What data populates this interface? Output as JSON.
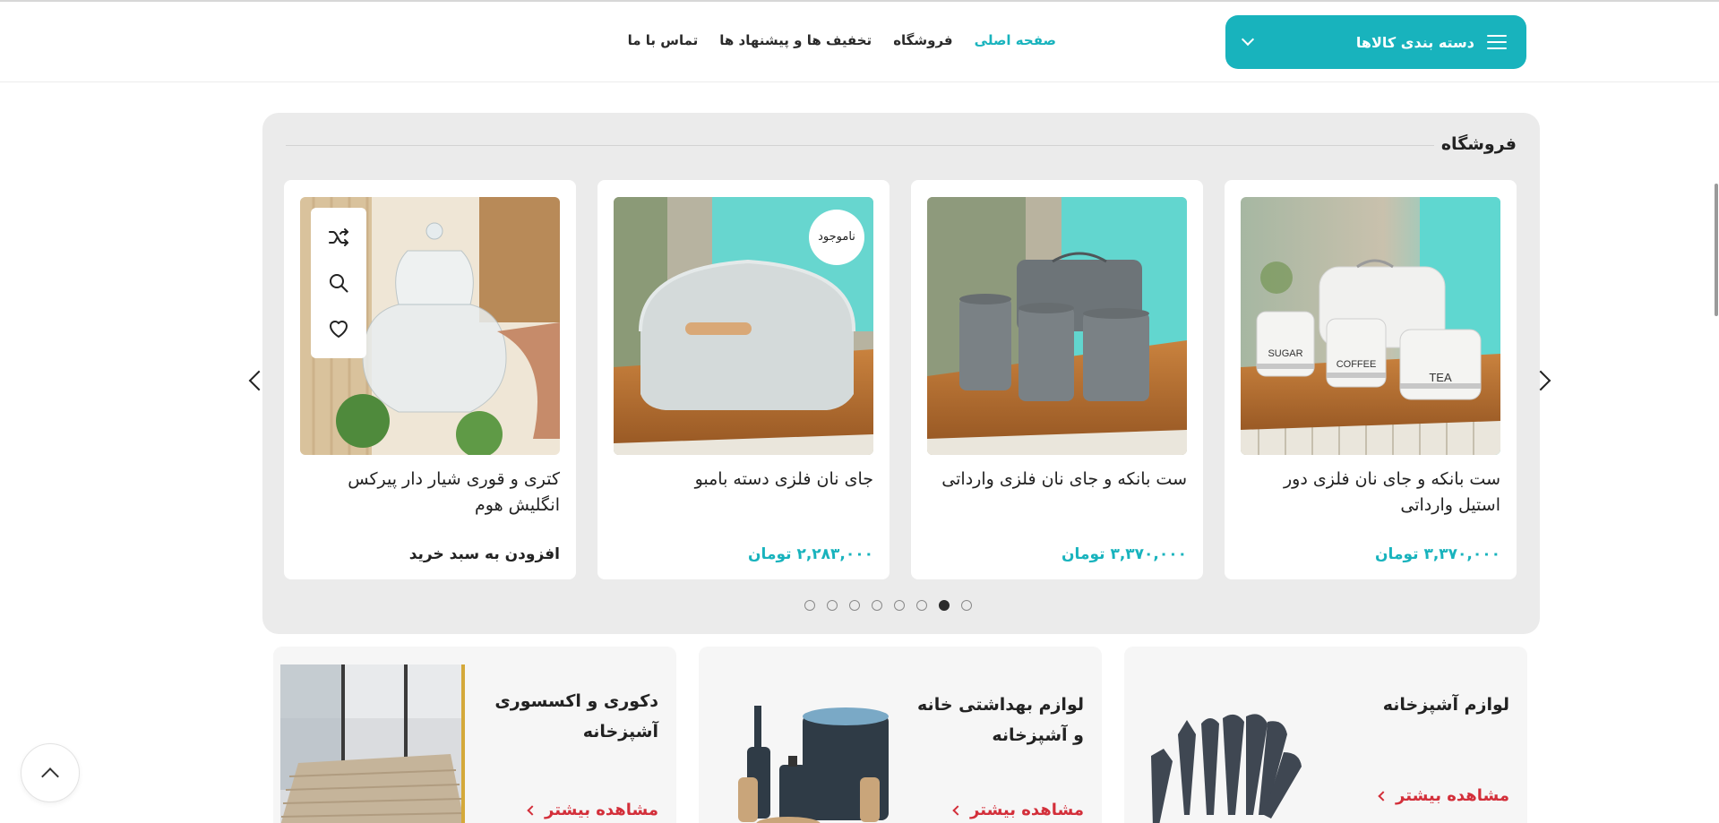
{
  "header": {
    "category_button_label": "دسته بندی کالاها",
    "nav": [
      {
        "label": "صفحه اصلی",
        "active": true
      },
      {
        "label": "فروشگاه",
        "active": false
      },
      {
        "label": "تخفیف ها و پیشنهاد ها",
        "active": false
      },
      {
        "label": "تماس با ما",
        "active": false
      }
    ]
  },
  "store": {
    "title": "فروشگاه",
    "products": [
      {
        "title": "ست بانکه و جای نان فلزی دور استیل وارداتی",
        "price": "۳,۳۷۰,۰۰۰ تومان"
      },
      {
        "title": "ست بانکه و جای نان فلزی وارداتی",
        "price": "۳,۳۷۰,۰۰۰ تومان"
      },
      {
        "title": "جای نان فلزی دسته بامبو",
        "price": "۲,۲۸۳,۰۰۰ تومان",
        "badge": "ناموجود"
      },
      {
        "title": "کتری و قوری شیار دار پیرکس انگلیش هوم",
        "action": "افزودن به سبد خرید"
      }
    ],
    "canister_labels": [
      "SUGAR",
      "COFFEE",
      "TEA"
    ],
    "pagination": {
      "total": 8,
      "active_index": 6
    }
  },
  "categories": [
    {
      "title_line1": "لوازم آشپزخانه",
      "title_line2": "",
      "more": "مشاهده بیشتر"
    },
    {
      "title_line1": "لوازم بهداشتی خانه",
      "title_line2": "و آشپزخانه",
      "more": "مشاهده بیشتر"
    },
    {
      "title_line1": "دکوری و اکسسوری",
      "title_line2": "آشپزخانه",
      "more": "مشاهده بیشتر"
    }
  ],
  "colors": {
    "accent": "#18b3bd",
    "link_red": "#d32f3a",
    "panel_bg": "#ebebeb"
  },
  "icons": [
    "menu-icon",
    "chevron-down-icon",
    "shuffle-icon",
    "search-icon",
    "heart-icon",
    "chevron-left-icon",
    "chevron-right-icon",
    "arrow-up-icon"
  ]
}
